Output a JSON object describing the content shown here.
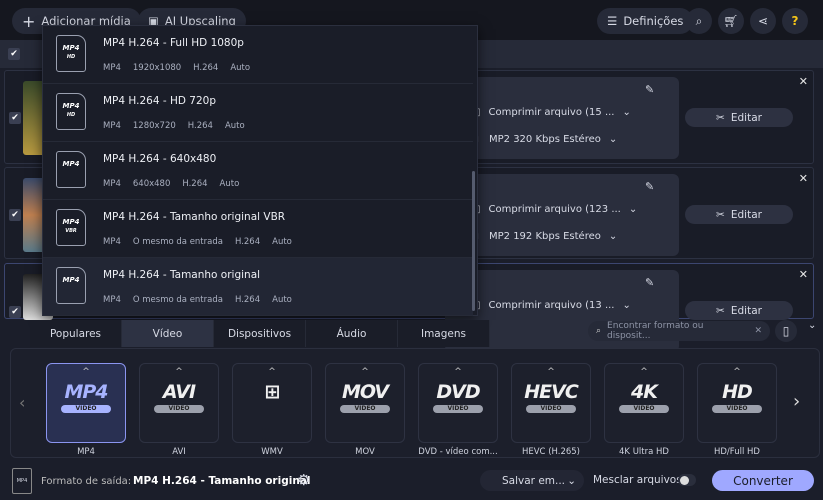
{
  "toolbar": {
    "add_media": "Adicionar mídia",
    "ai_upscaling": "AI Upscaling",
    "settings": "Definições"
  },
  "files": [
    {
      "compress": "Comprimir arquivo (15 ...",
      "audio": "MP2 320 Kbps Estéreo",
      "edit": "Editar"
    },
    {
      "compress": "Comprimir arquivo (123 ...",
      "audio": "MP2 192 Kbps Estéreo",
      "edit": "Editar"
    },
    {
      "compress": "Comprimir arquivo (13 ...",
      "edit": "Editar"
    }
  ],
  "presets": [
    {
      "icon": "MP4",
      "sub": "HD",
      "title": "MP4 H.264 - Full HD 1080p",
      "meta": [
        "MP4",
        "1920x1080",
        "H.264",
        "Auto"
      ]
    },
    {
      "icon": "MP4",
      "sub": "HD",
      "title": "MP4 H.264 - HD 720p",
      "meta": [
        "MP4",
        "1280x720",
        "H.264",
        "Auto"
      ]
    },
    {
      "icon": "MP4",
      "sub": "",
      "title": "MP4 H.264 - 640x480",
      "meta": [
        "MP4",
        "640x480",
        "H.264",
        "Auto"
      ]
    },
    {
      "icon": "MP4",
      "sub": "VBR",
      "title": "MP4 H.264 - Tamanho original VBR",
      "meta": [
        "MP4",
        "O mesmo da entrada",
        "H.264",
        "Auto"
      ]
    },
    {
      "icon": "MP4",
      "sub": "",
      "title": "MP4 H.264 - Tamanho original",
      "meta": [
        "MP4",
        "O mesmo da entrada",
        "H.264",
        "Auto"
      ]
    }
  ],
  "tabs": [
    "Populares",
    "Vídeo",
    "Dispositivos",
    "Áudio",
    "Imagens"
  ],
  "search_placeholder": "Encontrar formato ou disposit...",
  "formats": [
    {
      "logo": "MP4",
      "badge": "VIDEO",
      "label": "MP4"
    },
    {
      "logo": "AVI",
      "badge": "VIDEO",
      "label": "AVI"
    },
    {
      "logo": "⊞",
      "badge": "",
      "label": "WMV"
    },
    {
      "logo": "MOV",
      "badge": "VIDEO",
      "label": "MOV"
    },
    {
      "logo": "DVD",
      "badge": "VIDEO",
      "label": "DVD - vídeo com..."
    },
    {
      "logo": "HEVC",
      "badge": "VIDEO",
      "label": "HEVC (H.265)"
    },
    {
      "logo": "4K",
      "badge": "VIDEO",
      "label": "4K Ultra HD"
    },
    {
      "logo": "HD",
      "badge": "VIDEO",
      "label": "HD/Full HD"
    }
  ],
  "footer": {
    "output_label": "Formato de saída:",
    "output_value": "MP4 H.264 - Tamanho original",
    "save": "Salvar em...",
    "merge": "Mesclar arquivos:",
    "convert": "Converter"
  },
  "colors": {
    "accent": "#9fa8ff",
    "bg": "#1b1e2a"
  }
}
